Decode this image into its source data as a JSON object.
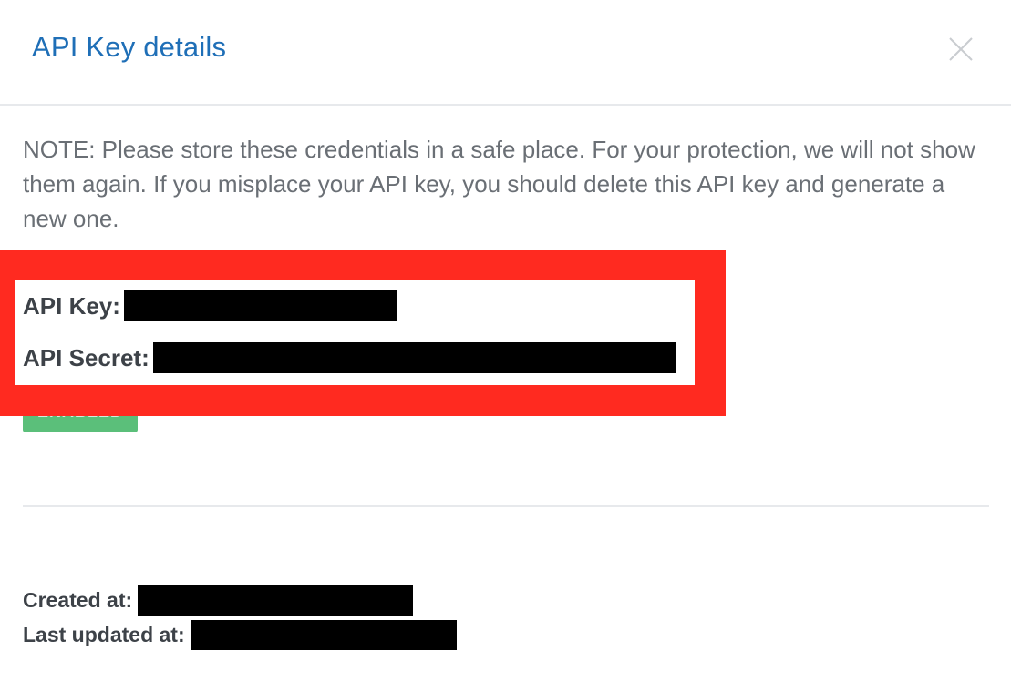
{
  "modal": {
    "title": "API Key details",
    "close_icon": "close-icon",
    "note": "NOTE: Please store these credentials in a safe place. For your protection, we will not show them again. If you misplace your API key, you should delete this API key and generate a new one.",
    "status_badge": "ENABLED",
    "credentials": {
      "api_key_label": "API Key:",
      "api_secret_label": "API Secret:"
    },
    "meta": {
      "created_label": "Created at:",
      "updated_label": "Last updated at:"
    }
  },
  "colors": {
    "title": "#1f6fb7",
    "highlight": "#ff2a20",
    "badge": "#5bbf7a",
    "redaction": "#000000"
  }
}
